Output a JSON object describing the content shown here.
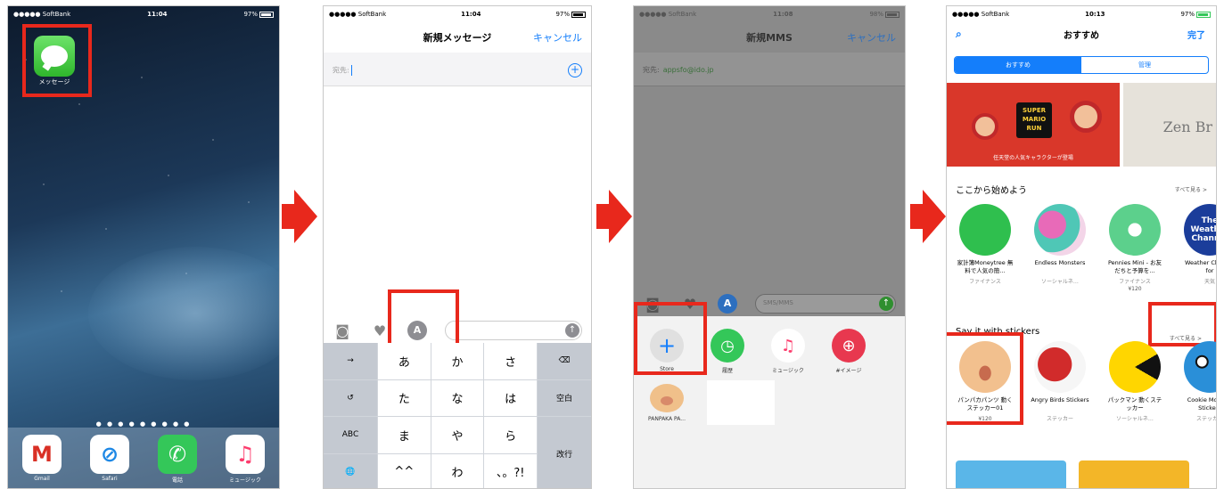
{
  "phone1": {
    "status": {
      "carrier": "●●●●● SoftBank",
      "time": "11:04",
      "battery": "97%"
    },
    "app_label": "メッセージ",
    "page_dots": "● ● ● ● ● ● ● ● ●",
    "dock": [
      {
        "label": "Gmail",
        "glyph": "M"
      },
      {
        "label": "Safari",
        "glyph": "⊘"
      },
      {
        "label": "電話",
        "glyph": "✆"
      },
      {
        "label": "ミュージック",
        "glyph": "♫"
      }
    ]
  },
  "phone2": {
    "status": {
      "carrier": "●●●●● SoftBank",
      "time": "11:04",
      "battery": "97%"
    },
    "title": "新規メッセージ",
    "cancel": "キャンセル",
    "to_label": "宛先:",
    "app_button": "A",
    "keyboard": {
      "r1": [
        "→",
        "あ",
        "か",
        "さ",
        "⌫"
      ],
      "r2": [
        "↺",
        "た",
        "な",
        "は",
        "空白"
      ],
      "r3": [
        "ABC",
        "ま",
        "や",
        "ら",
        "改行"
      ],
      "r4": [
        "🌐",
        "^^",
        "わ",
        "、。?!"
      ]
    }
  },
  "phone3": {
    "status": {
      "carrier": "●●●●● SoftBank",
      "time": "11:08",
      "battery": "98%"
    },
    "title": "新規MMS",
    "cancel": "キャンセル",
    "to_label": "宛先:",
    "to_value": "appsfo@ido.jp",
    "field_placeholder": "SMS/MMS",
    "drawer_apps": [
      {
        "label": "Store",
        "glyph": "+"
      },
      {
        "label": "履歴",
        "glyph": "◷"
      },
      {
        "label": "ミュージック",
        "glyph": "♫"
      },
      {
        "label": "#イメージ",
        "glyph": "⊕"
      }
    ],
    "sticker_label": "PANPAKA PA..."
  },
  "phone4": {
    "status": {
      "carrier": "●●●●● SoftBank",
      "time": "10:13",
      "battery": "97%"
    },
    "title": "おすすめ",
    "done": "完了",
    "segments": [
      "おすすめ",
      "管理"
    ],
    "banner_caption": "任天堂の人気キャラクターが登場",
    "banner_logo": "SUPER MARIO RUN",
    "banner_b": "Zen Br",
    "section1": {
      "title": "ここから始めよう",
      "see_all": "すべて見る >",
      "apps": [
        {
          "name": "家計簿Moneytree 無料で人気の簡…",
          "category": "ファイナンス",
          "price": ""
        },
        {
          "name": "Endless Monsters",
          "category": "ソーシャルネ…",
          "price": ""
        },
        {
          "name": "Pennies Mini - お友だちと予算を…",
          "category": "ファイナンス",
          "price": "¥120"
        },
        {
          "name": "Weather Channel for",
          "category": "天気",
          "price": ""
        }
      ],
      "weather_icon_text": "The Weather Channel"
    },
    "section2": {
      "title": "Say it with stickers",
      "see_all": "すべて見る >",
      "apps": [
        {
          "name": "パンパカパンツ 動くステッカー01",
          "category": "",
          "price": "¥120"
        },
        {
          "name": "Angry Birds Stickers",
          "category": "ステッカー",
          "price": ""
        },
        {
          "name": "パックマン 動くステッカー",
          "category": "ソーシャルネ…",
          "price": ""
        },
        {
          "name": "Cookie Monster Stickers",
          "category": "ステッカー",
          "price": ""
        }
      ]
    },
    "highlight_color": "#e8281c"
  }
}
